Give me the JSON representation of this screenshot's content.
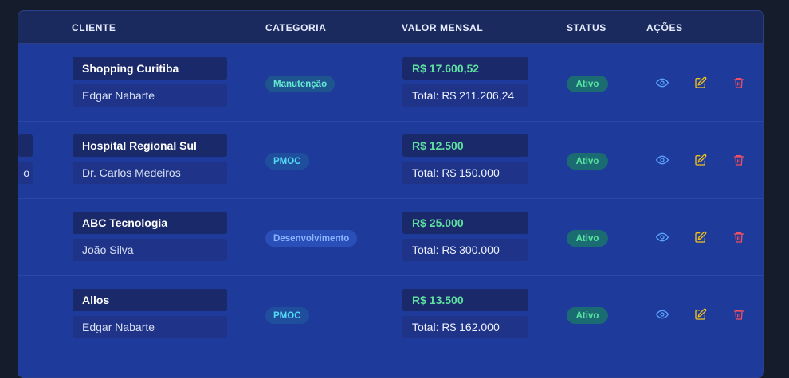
{
  "table": {
    "headers": {
      "cliente": "CLIENTE",
      "categoria": "CATEGORIA",
      "valor_mensal": "VALOR MENSAL",
      "status": "STATUS",
      "acoes": "AÇÕES"
    },
    "rows": [
      {
        "client_name": "Shopping Curitiba",
        "client_contact": "Edgar Nabarte",
        "category": "Manutenção",
        "monthly_value": "R$ 17.600,52",
        "total_value": "Total: R$ 211.206,24",
        "status": "Ativo"
      },
      {
        "client_name": "Hospital Regional Sul",
        "client_contact": "Dr. Carlos Medeiros",
        "category": "PMOC",
        "monthly_value": "R$ 12.500",
        "total_value": "Total: R$ 150.000",
        "status": "Ativo",
        "truncated_left_text": "o"
      },
      {
        "client_name": "ABC Tecnologia",
        "client_contact": "João Silva",
        "category": "Desenvolvimento",
        "monthly_value": "R$ 25.000",
        "total_value": "Total: R$ 300.000",
        "status": "Ativo"
      },
      {
        "client_name": "Allos",
        "client_contact": "Edgar Nabarte",
        "category": "PMOC",
        "monthly_value": "R$ 13.500",
        "total_value": "Total: R$ 162.000",
        "status": "Ativo"
      }
    ]
  },
  "icons": {
    "view": "eye-icon",
    "edit": "edit-icon",
    "delete": "trash-icon"
  },
  "colors": {
    "background": "#151c2b",
    "panel": "#1e3a9a",
    "header": "#1b2a5e",
    "monthly_value": "#5fe0a1",
    "view_icon": "#5aa2ff",
    "edit_icon": "#f1c21b",
    "delete_icon": "#ef4f62"
  }
}
